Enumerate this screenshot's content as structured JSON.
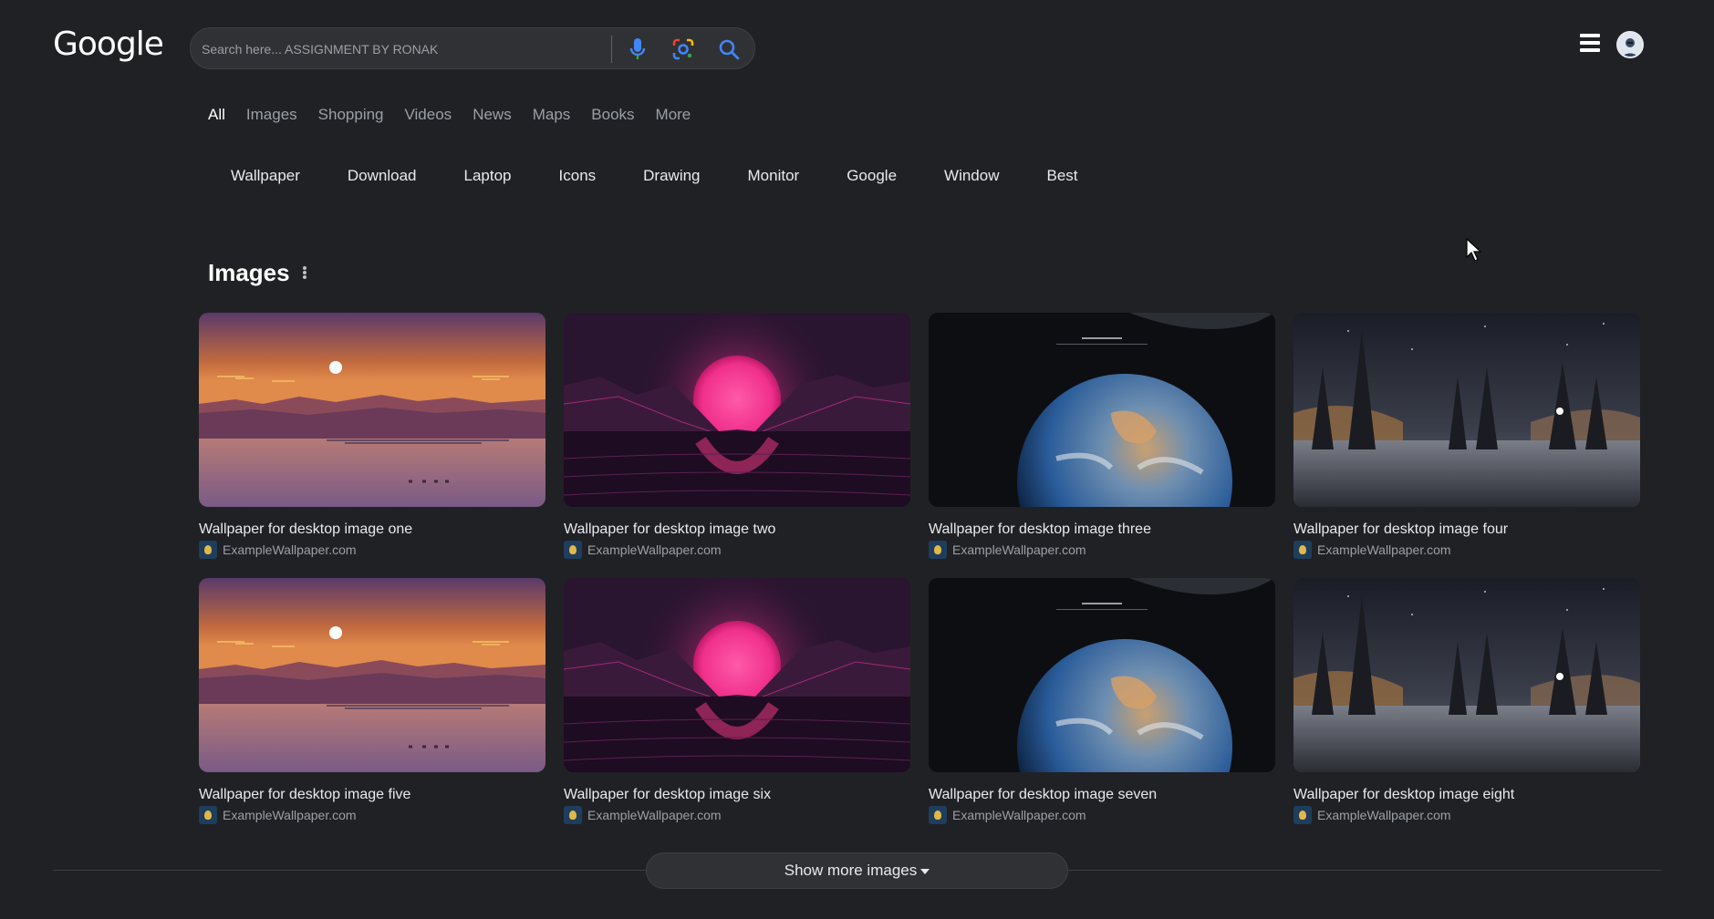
{
  "header": {
    "logo": "Google",
    "search_placeholder": "Search here... ASSIGNMENT BY RONAK",
    "icons": [
      "mic-icon",
      "lens-icon",
      "search-icon",
      "menu-icon",
      "avatar"
    ]
  },
  "tabs": [
    {
      "label": "All",
      "active": true
    },
    {
      "label": "Images"
    },
    {
      "label": "Shopping"
    },
    {
      "label": "Videos"
    },
    {
      "label": "News"
    },
    {
      "label": "Maps"
    },
    {
      "label": "Books"
    },
    {
      "label": "More"
    }
  ],
  "chips": [
    "Wallpaper",
    "Download",
    "Laptop",
    "Icons",
    "Drawing",
    "Monitor",
    "Google",
    "Window",
    "Best"
  ],
  "images_section": {
    "title": "Images",
    "results": [
      {
        "title": "Wallpaper for desktop image one",
        "source": "ExampleWallpaper.com",
        "scene": "sunset-lake"
      },
      {
        "title": "Wallpaper for desktop image two",
        "source": "ExampleWallpaper.com",
        "scene": "neon-sun"
      },
      {
        "title": "Wallpaper for desktop image three",
        "source": "ExampleWallpaper.com",
        "scene": "earth"
      },
      {
        "title": "Wallpaper for desktop image four",
        "source": "ExampleWallpaper.com",
        "scene": "night-forest"
      },
      {
        "title": "Wallpaper for desktop image five",
        "source": "ExampleWallpaper.com",
        "scene": "sunset-lake"
      },
      {
        "title": "Wallpaper for desktop image six",
        "source": "ExampleWallpaper.com",
        "scene": "neon-sun"
      },
      {
        "title": "Wallpaper for desktop image seven",
        "source": "ExampleWallpaper.com",
        "scene": "earth"
      },
      {
        "title": "Wallpaper for desktop image eight",
        "source": "ExampleWallpaper.com",
        "scene": "night-forest"
      }
    ]
  },
  "show_more_label": "Show more images",
  "colors": {
    "background": "#202124",
    "surface": "#303134",
    "text_primary": "#e8eaed",
    "text_secondary": "#9aa0a6",
    "accent_blue": "#4285f4"
  }
}
